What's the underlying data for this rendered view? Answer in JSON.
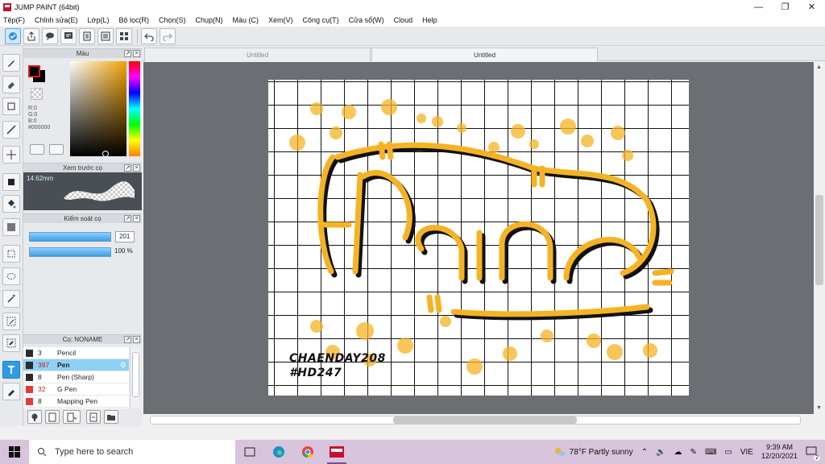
{
  "window": {
    "title": "JUMP PAINT (64bit)",
    "minimize": "—",
    "maximize": "❐",
    "close": "✕"
  },
  "menu": [
    "Tệp(F)",
    "Chỉnh sửa(E)",
    "Lớp(L)",
    "Bộ lọc(R)",
    "Chọn(S)",
    "Chụp(N)",
    "Màu (C)",
    "Xem(V)",
    "Công cụ(T)",
    "Cửa sổ(W)",
    "Cloud",
    "Help"
  ],
  "panels": {
    "color": {
      "title": "Màu",
      "r": "R:0",
      "g": "G:0",
      "b": "B:0",
      "hex": "#000000"
    },
    "brush_preview": {
      "title": "Xem trước cọ",
      "size": "14.62mm"
    },
    "brush_control": {
      "title": "Kiểm soát cọ",
      "size_value": "201",
      "opacity_value": "100 %"
    },
    "brush_list": {
      "title": "Cọ: NONAME",
      "items": [
        {
          "size": "3",
          "name": "Pencil",
          "color": "#2b2b2b",
          "size_red": false,
          "selected": false
        },
        {
          "size": "397",
          "name": "Pen",
          "color": "#2b2b2b",
          "size_red": true,
          "selected": true
        },
        {
          "size": "8",
          "name": "Pen (Sharp)",
          "color": "#2b2b2b",
          "size_red": false,
          "selected": false
        },
        {
          "size": "32",
          "name": "G Pen",
          "color": "#e53a3a",
          "size_red": true,
          "selected": false
        },
        {
          "size": "8",
          "name": "Mapping Pen",
          "color": "#e53a3a",
          "size_red": false,
          "selected": false
        }
      ]
    }
  },
  "tabs": [
    "Untitled",
    "Untitled"
  ],
  "canvas": {
    "signature_line1": "CHAENDAY208",
    "signature_line2": "#HD247",
    "accent": "#f5b324"
  },
  "taskbar": {
    "search_placeholder": "Type here to search",
    "weather": "78°F  Partly sunny",
    "lang": "VIE",
    "time": "9:39 AM",
    "date": "12/20/2021",
    "notifications": "2"
  }
}
